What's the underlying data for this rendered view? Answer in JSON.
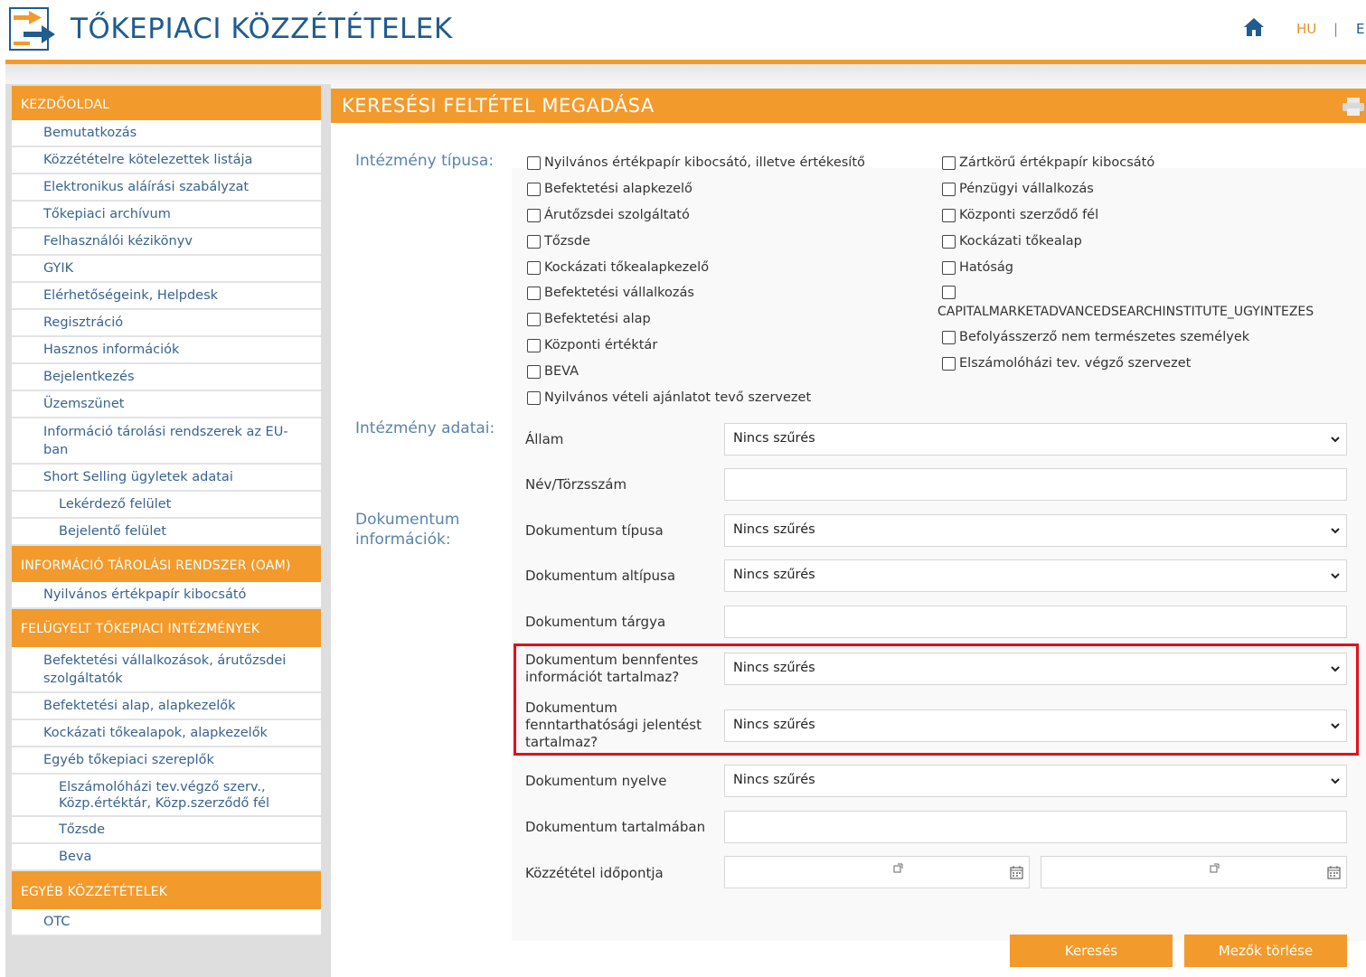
{
  "header": {
    "title": "TŐKEPIACI KÖZZÉTÉTELEK",
    "logo_icon": "arrows-document-logo",
    "home_icon": "home-icon",
    "lang_hu": "HU",
    "lang_sep": "|",
    "lang_en": "E"
  },
  "sidebar": {
    "sections": [
      {
        "title": "KEZDŐOLDAL",
        "items": [
          {
            "label": "Bemutatkozás"
          },
          {
            "label": "Közzétételre kötelezettek listája"
          },
          {
            "label": "Elektronikus aláírási szabályzat"
          },
          {
            "label": "Tőkepiaci archívum"
          },
          {
            "label": "Felhasználói kézikönyv"
          },
          {
            "label": "GYIK"
          },
          {
            "label": "Elérhetőségeink, Helpdesk"
          },
          {
            "label": "Regisztráció"
          },
          {
            "label": "Hasznos információk"
          },
          {
            "label": "Bejelentkezés"
          },
          {
            "label": "Üzemszünet"
          },
          {
            "label": "Információ tárolási rendszerek az EU-ban"
          },
          {
            "label": "Short Selling ügyletek adatai"
          },
          {
            "label": "Lekérdező felület"
          },
          {
            "label": "Bejelentő felület"
          }
        ]
      },
      {
        "title": "INFORMÁCIÓ TÁROLÁSI RENDSZER (OAM)",
        "items": [
          {
            "label": "Nyilvános értékpapír kibocsátó"
          }
        ]
      },
      {
        "title": "FELÜGYELT TŐKEPIACI INTÉZMÉNYEK",
        "items": [
          {
            "label": "Befektetési vállalkozások, árutőzsdei szolgáltatók"
          },
          {
            "label": "Befektetési alap, alapkezelők"
          },
          {
            "label": "Kockázati tőkealapok, alapkezelők"
          },
          {
            "label": "Egyéb tőkepiaci szereplők"
          },
          {
            "label": "Elszámolóházi tev.végző szerv., Közp.értéktár, Közp.szerződő fél"
          },
          {
            "label": "Tőzsde"
          },
          {
            "label": "Beva"
          }
        ]
      },
      {
        "title": "EGYÉB KÖZZÉTÉTELEK",
        "items": [
          {
            "label": "OTC"
          }
        ]
      }
    ]
  },
  "main": {
    "title": "KERESÉSI FELTÉTEL MEGADÁSA",
    "print_icon": "printer-icon",
    "institution_type_label": "Intézmény típusa:",
    "institution_types_left": [
      "Nyilvános értékpapír kibocsátó, illetve értékesítő",
      "Befektetési alapkezelő",
      "Árutőzsdei szolgáltató",
      "Tőzsde",
      "Kockázati tőkealapkezelő",
      "Befektetési vállalkozás",
      "Befektetési alap",
      "Központi értéktár",
      "BEVA",
      "Nyilvános vételi ajánlatot tevő szervezet"
    ],
    "institution_types_right": [
      "Zártkörű értékpapír kibocsátó",
      "Pénzügyi vállalkozás",
      "Központi szerződő fél",
      "Kockázati tőkealap",
      "Hatóság",
      "CAPITALMARKETADVANCEDSEARCHINSTITUTE_UGYINTEZES",
      "Befolyásszerző nem természetes személyek",
      "Elszámolóházi tev. végző szervezet"
    ],
    "institution_data_label": "Intézmény adatai:",
    "document_info_label": "Dokumentum információk:",
    "fields": {
      "allam": {
        "label": "Állam",
        "value": "Nincs szűrés"
      },
      "nev": {
        "label": "Név/Törzsszám",
        "value": ""
      },
      "dok_tipus": {
        "label": "Dokumentum típusa",
        "value": "Nincs szűrés"
      },
      "dok_altipus": {
        "label": "Dokumentum altípusa",
        "value": "Nincs szűrés"
      },
      "dok_targy": {
        "label": "Dokumentum tárgya",
        "value": ""
      },
      "bennfentes": {
        "label": "Dokumentum bennfentes információt tartalmaz?",
        "value": "Nincs szűrés"
      },
      "fenntarthatosagi": {
        "label": "Dokumentum fenntarthatósági jelentést tartalmaz?",
        "value": "Nincs szűrés"
      },
      "nyelv": {
        "label": "Dokumentum nyelve",
        "value": "Nincs szűrés"
      },
      "tartalom": {
        "label": "Dokumentum tartalmában",
        "value": ""
      },
      "idopont": {
        "label": "Közzététel időpontja",
        "from": "",
        "to": ""
      }
    },
    "buttons": {
      "search": "Keresés",
      "clear": "Mezők törlése"
    }
  },
  "colors": {
    "orange": "#f39a2c",
    "blue_title": "#1f5c8f",
    "link_blue": "#39638f",
    "highlight_red": "#e0111b"
  }
}
